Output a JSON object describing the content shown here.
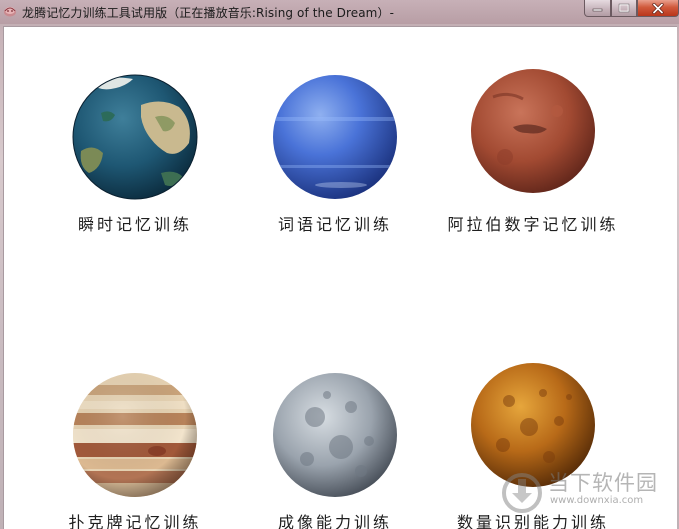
{
  "window": {
    "title": "龙腾记忆力训练工具试用版（正在播放音乐:Rising of the Dream）-"
  },
  "icons": {
    "app": "app-logo-icon",
    "minimize": "minimize-icon",
    "maximize": "maximize-icon",
    "close": "close-icon"
  },
  "colors": {
    "titlebar": "#bda5ac",
    "close_button": "#c9462a",
    "content_background": "#ffffff"
  },
  "tiles": [
    {
      "label": "瞬时记忆训练",
      "planet": "earth"
    },
    {
      "label": "词语记忆训练",
      "planet": "neptune"
    },
    {
      "label": "阿拉伯数字记忆训练",
      "planet": "mars"
    },
    {
      "label": "扑克牌记忆训练",
      "planet": "jupiter"
    },
    {
      "label": "成像能力训练",
      "planet": "moon"
    },
    {
      "label": "数量识别能力训练",
      "planet": "venus"
    }
  ],
  "watermark": {
    "brand": "当下软件园",
    "url": "www.downxia.com"
  }
}
